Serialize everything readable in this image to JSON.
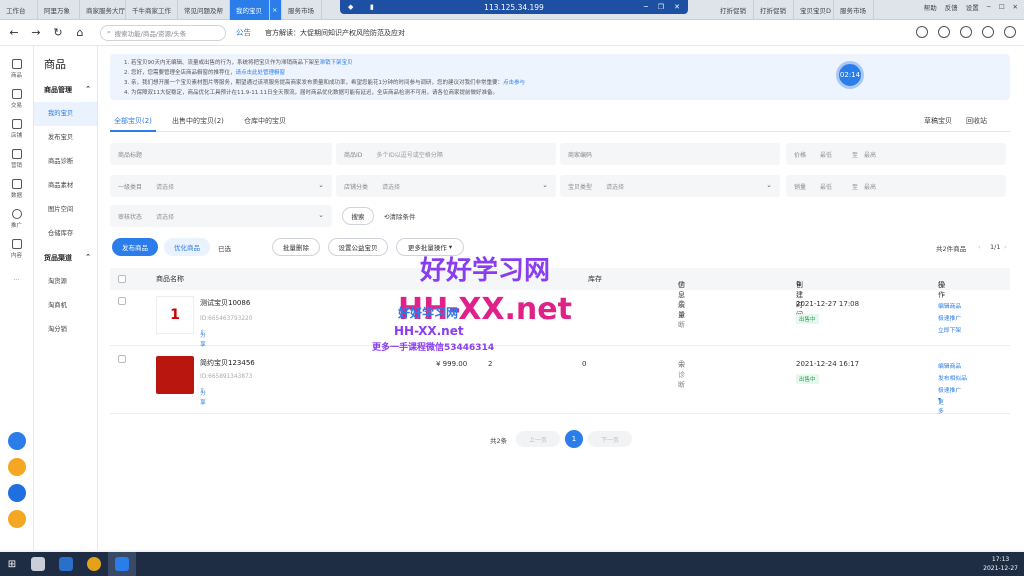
{
  "browser_tabs": [
    "工作台",
    "阿里万象",
    "商家服务大厅",
    "千牛商家工作",
    "常见问题及帮",
    "我的宝贝",
    "服务市场",
    "打折促销",
    "打折促销",
    "宝贝宝贝D",
    "服务市场"
  ],
  "remote_title": "113.125.34.199",
  "window_controls": {
    "help": "帮助",
    "feedback": "反馈",
    "settings": "设置"
  },
  "nav": {
    "search_placeholder": "搜索功能/商品/资源/头条",
    "announcement_label": "公告",
    "announcement_text": "官方解读：大促期间知识产权风险防范及应对"
  },
  "rail": [
    "商品",
    "交易",
    "店铺",
    "营销",
    "数据",
    "推广",
    "内容",
    "..."
  ],
  "sidebar": {
    "title": "商品",
    "group1": "商品管理",
    "items1": [
      "我的宝贝",
      "发布宝贝",
      "商品诊断",
      "商品素材",
      "图片空间",
      "仓储库存"
    ],
    "group2": "货品渠道",
    "items2": [
      "淘货源",
      "淘商机",
      "淘分销"
    ]
  },
  "notices": [
    {
      "num": "1.",
      "text": "若宝贝90天内无编辑、流量或出售的行为，系统将把宝贝作为滞销商品下架至",
      "link": "滞销下架宝贝"
    },
    {
      "num": "2.",
      "text": "您好，您需要管理全店商品橱窗的推荐位，",
      "link": "请点击此处管理橱窗"
    },
    {
      "num": "3.",
      "text": "亲，我们想开展一个宝贝素材图片等服务，期望通过该项服务提高商家发布质量和成功率，希望您能花1分钟的时间参与调研，您的建议对我们非常重要：",
      "link": "点击参与"
    },
    {
      "num": "4.",
      "text": "为保障双11大促稳定，商品优化工具预计在11.9-11.11日全天限流，届时商品优化数据可能有延迟，全店商品检测不可用，请各位商家提前做好准备。",
      "link": ""
    }
  ],
  "timer": "02:14",
  "tabs": {
    "all": "全部宝贝(2)",
    "on_sale": "出售中的宝贝(2)",
    "warehouse": "仓库中的宝贝",
    "draft": "草稿宝贝",
    "recycle": "回收站"
  },
  "filters": {
    "title": "商品标题",
    "id_label": "商品ID",
    "id_ph": "多个ID以逗号或空格分隔",
    "code": "商家编码",
    "price": "价格",
    "low": "最低",
    "high": "最高",
    "tilde": "至",
    "cat1": "一级类目",
    "cat_shop": "店铺分类",
    "baby_type": "宝贝类型",
    "choose": "请选择",
    "sales": "销量",
    "audit": "审核状态",
    "search": "搜索",
    "clear": "清除条件"
  },
  "actions": {
    "publish": "发布商品",
    "optimize": "优化商品",
    "selected": "已选",
    "batch_delete": "批量删除",
    "public_welfare": "设置公益宝贝",
    "more_batch": "更多批量操作",
    "count": "共2件商品",
    "page": "1/1"
  },
  "table": {
    "headers": {
      "name": "商品名称",
      "stock_short": "库存",
      "info": "信息质量",
      "created": "创建时间",
      "ops": "操作"
    },
    "rows": [
      {
        "title": "测试宝贝10086",
        "id": "ID:665463793220",
        "share": "分享",
        "status_icon": "未诊断",
        "time": "2021-12-27 17:08",
        "badge": "出售中",
        "ops": [
          "编辑商品",
          "极速推广",
          "立即下架"
        ]
      },
      {
        "title": "简约宝贝123456",
        "id": "ID:665891343873",
        "share": "分享",
        "price": "¥ 999.00",
        "stock": "2",
        "sold": "0",
        "status_icon": "未诊断",
        "time": "2021-12-24 16:17",
        "badge": "出售中",
        "ops": [
          "编辑商品",
          "发布相似品",
          "极速推广",
          "更多"
        ]
      }
    ]
  },
  "pagination": {
    "total": "共2条",
    "prev": "上一页",
    "page": "1",
    "next": "下一页"
  },
  "watermark": {
    "big": "好好学习网",
    "site": "HH-XX.net",
    "site2": "HH-XX.net",
    "contact": "更多一手课程微信53446314",
    "small": "好好学习网"
  },
  "taskbar": {
    "time": "17:13",
    "date": "2021-12-27"
  },
  "colors": {
    "accent": "#2b7de9",
    "status_green": "#2a9d55"
  }
}
